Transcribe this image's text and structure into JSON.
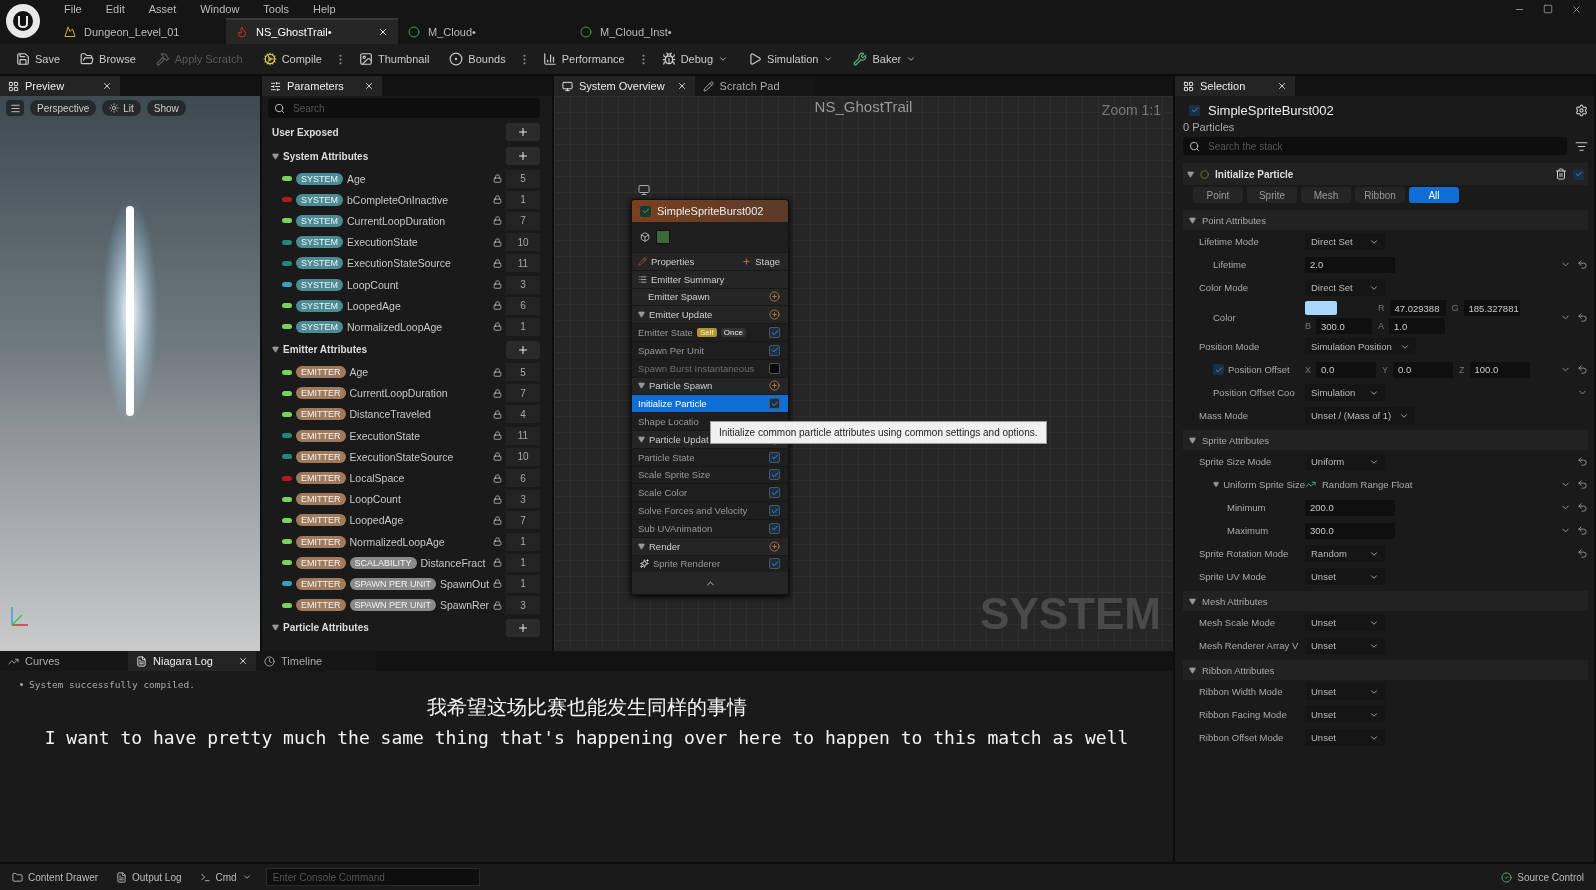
{
  "menu": [
    "File",
    "Edit",
    "Asset",
    "Window",
    "Tools",
    "Help"
  ],
  "documents": [
    {
      "label": "Dungeon_Level_01",
      "kind": "level",
      "selected": false,
      "closable": false
    },
    {
      "label": "NS_GhostTrail•",
      "kind": "system",
      "selected": true,
      "closable": true
    },
    {
      "label": "M_Cloud•",
      "kind": "material",
      "selected": false,
      "closable": false
    },
    {
      "label": "M_Cloud_Inst•",
      "kind": "material",
      "selected": false,
      "closable": false
    }
  ],
  "toolbar": [
    {
      "label": "Save",
      "kind": "save",
      "disabled": false,
      "menu": false,
      "options": false
    },
    {
      "label": "Browse",
      "kind": "browse",
      "disabled": false,
      "menu": false,
      "options": false
    },
    {
      "label": "Apply Scratch",
      "kind": "apply",
      "disabled": true,
      "menu": false,
      "options": false
    },
    {
      "label": "Compile",
      "kind": "compile",
      "disabled": false,
      "menu": false,
      "options": true
    },
    {
      "label": "Thumbnail",
      "kind": "thumbnail",
      "disabled": false,
      "menu": false,
      "options": false
    },
    {
      "label": "Bounds",
      "kind": "bounds",
      "disabled": false,
      "menu": false,
      "options": true
    },
    {
      "label": "Performance",
      "kind": "performance",
      "disabled": false,
      "menu": false,
      "options": true
    },
    {
      "label": "Debug",
      "kind": "debug",
      "disabled": false,
      "menu": true,
      "options": false
    },
    {
      "label": "Simulation",
      "kind": "simulation",
      "disabled": false,
      "menu": true,
      "options": false
    },
    {
      "label": "Baker",
      "kind": "baker",
      "disabled": false,
      "menu": true,
      "options": false
    }
  ],
  "preview": {
    "tab": "Preview",
    "view_buttons": [
      {
        "label": "Perspective",
        "kind": "plain"
      },
      {
        "label": "Lit",
        "kind": "lit"
      },
      {
        "label": "Show",
        "kind": "plain"
      }
    ]
  },
  "parameters": {
    "tab": "Parameters",
    "search": {
      "placeholder": "Search"
    },
    "user_exposed": "User Exposed",
    "sections": [
      {
        "title": "System Attributes",
        "expanded": true,
        "rows": [
          {
            "color": "#7ad25a",
            "tags": [
              {
                "text": "SYSTEM",
                "kind": "system"
              }
            ],
            "name": "Age",
            "locked": true,
            "count": "5"
          },
          {
            "color": "#b01c1c",
            "tags": [
              {
                "text": "SYSTEM",
                "kind": "system"
              }
            ],
            "name": "bCompleteOnInactive",
            "locked": true,
            "count": "1"
          },
          {
            "color": "#7ad25a",
            "tags": [
              {
                "text": "SYSTEM",
                "kind": "system"
              }
            ],
            "name": "CurrentLoopDuration",
            "locked": true,
            "count": "7"
          },
          {
            "color": "#1f8a7a",
            "tags": [
              {
                "text": "SYSTEM",
                "kind": "system"
              }
            ],
            "name": "ExecutionState",
            "locked": true,
            "count": "10"
          },
          {
            "color": "#1f8a7a",
            "tags": [
              {
                "text": "SYSTEM",
                "kind": "system"
              }
            ],
            "name": "ExecutionStateSource",
            "locked": true,
            "count": "11"
          },
          {
            "color": "#3aa0c0",
            "tags": [
              {
                "text": "SYSTEM",
                "kind": "system"
              }
            ],
            "name": "LoopCount",
            "locked": true,
            "count": "3"
          },
          {
            "color": "#7ad25a",
            "tags": [
              {
                "text": "SYSTEM",
                "kind": "system"
              }
            ],
            "name": "LoopedAge",
            "locked": true,
            "count": "6"
          },
          {
            "color": "#7ad25a",
            "tags": [
              {
                "text": "SYSTEM",
                "kind": "system"
              }
            ],
            "name": "NormalizedLoopAge",
            "locked": true,
            "count": "1"
          }
        ]
      },
      {
        "title": "Emitter Attributes",
        "expanded": true,
        "rows": [
          {
            "color": "#7ad25a",
            "tags": [
              {
                "text": "EMITTER",
                "kind": "emitter"
              }
            ],
            "name": "Age",
            "locked": true,
            "count": "5"
          },
          {
            "color": "#7ad25a",
            "tags": [
              {
                "text": "EMITTER",
                "kind": "emitter"
              }
            ],
            "name": "CurrentLoopDuration",
            "locked": true,
            "count": "7"
          },
          {
            "color": "#7ad25a",
            "tags": [
              {
                "text": "EMITTER",
                "kind": "emitter"
              }
            ],
            "name": "DistanceTraveled",
            "locked": true,
            "count": "4"
          },
          {
            "color": "#1f8a7a",
            "tags": [
              {
                "text": "EMITTER",
                "kind": "emitter"
              }
            ],
            "name": "ExecutionState",
            "locked": true,
            "count": "11"
          },
          {
            "color": "#1f8a7a",
            "tags": [
              {
                "text": "EMITTER",
                "kind": "emitter"
              }
            ],
            "name": "ExecutionStateSource",
            "locked": true,
            "count": "10"
          },
          {
            "color": "#b01c1c",
            "tags": [
              {
                "text": "EMITTER",
                "kind": "emitter"
              }
            ],
            "name": "LocalSpace",
            "locked": true,
            "count": "6"
          },
          {
            "color": "#7ad25a",
            "tags": [
              {
                "text": "EMITTER",
                "kind": "emitter"
              }
            ],
            "name": "LoopCount",
            "locked": true,
            "count": "3"
          },
          {
            "color": "#7ad25a",
            "tags": [
              {
                "text": "EMITTER",
                "kind": "emitter"
              }
            ],
            "name": "LoopedAge",
            "locked": true,
            "count": "7"
          },
          {
            "color": "#7ad25a",
            "tags": [
              {
                "text": "EMITTER",
                "kind": "emitter"
              }
            ],
            "name": "NormalizedLoopAge",
            "locked": true,
            "count": "1"
          },
          {
            "color": "#7ad25a",
            "tags": [
              {
                "text": "EMITTER",
                "kind": "emitter"
              },
              {
                "text": "SCALABILITY",
                "kind": "module"
              }
            ],
            "name": "DistanceFract",
            "locked": true,
            "count": "1"
          },
          {
            "color": "#3aa0c0",
            "tags": [
              {
                "text": "EMITTER",
                "kind": "emitter"
              },
              {
                "text": "SPAWN PER UNIT",
                "kind": "module"
              }
            ],
            "name": "SpawnOut",
            "locked": true,
            "count": "1"
          },
          {
            "color": "#7ad25a",
            "tags": [
              {
                "text": "EMITTER",
                "kind": "emitter"
              },
              {
                "text": "SPAWN PER UNIT",
                "kind": "module"
              }
            ],
            "name": "SpawnRer",
            "locked": true,
            "count": "3"
          }
        ]
      },
      {
        "title": "Particle Attributes",
        "expanded": true
      }
    ]
  },
  "graph": {
    "tabs": [
      {
        "label": "System Overview",
        "selected": true,
        "closable": true
      },
      {
        "label": "Scratch Pad",
        "selected": false,
        "closable": false
      }
    ],
    "title": "NS_GhostTrail",
    "zoom": "Zoom 1:1",
    "graph_type": "SYSTEM",
    "node": {
      "title": "SimpleSpriteBurst002",
      "enabled": true,
      "rows": [
        {
          "kind": "properties",
          "label": "Properties",
          "action": "Stage",
          "selected": false
        },
        {
          "kind": "summary",
          "label": "Emitter Summary",
          "selected": false
        },
        {
          "kind": "stage",
          "label": "Emitter Spawn",
          "selected": false
        },
        {
          "kind": "group",
          "label": "Emitter Update",
          "expanded": true,
          "selected": false
        },
        {
          "kind": "module",
          "label": "Emitter State",
          "tags": [
            "Self",
            "Once"
          ],
          "checked": true,
          "disabled": false,
          "selected": false
        },
        {
          "kind": "module",
          "label": "Spawn Per Unit",
          "checked": true,
          "disabled": false,
          "selected": false
        },
        {
          "kind": "module",
          "label": "Spawn Burst Instantaneous",
          "checked": false,
          "disabled": true,
          "selected": false
        },
        {
          "kind": "group",
          "label": "Particle Spawn",
          "expanded": true,
          "selected": false
        },
        {
          "kind": "module",
          "label": "Initialize Particle",
          "checked": true,
          "disabled": false,
          "selected": true
        },
        {
          "kind": "module",
          "label": "Shape Locatio",
          "disabled": false,
          "selected": false
        },
        {
          "kind": "group",
          "label": "Particle Updat",
          "expanded": true,
          "selected": false
        },
        {
          "kind": "module",
          "label": "Particle State",
          "checked": true,
          "disabled": false,
          "selected": false
        },
        {
          "kind": "module",
          "label": "Scale Sprite Size",
          "checked": true,
          "disabled": false,
          "selected": false
        },
        {
          "kind": "module",
          "label": "Scale Color",
          "checked": true,
          "disabled": false,
          "selected": false
        },
        {
          "kind": "module",
          "label": "Solve Forces and Velocity",
          "checked": true,
          "disabled": false,
          "selected": false
        },
        {
          "kind": "module",
          "label": "Sub UVAnimation",
          "checked": true,
          "disabled": false,
          "selected": false
        },
        {
          "kind": "group",
          "label": "Render",
          "expanded": true,
          "selected": false
        },
        {
          "kind": "renderer",
          "label": "Sprite Renderer",
          "checked": true,
          "disabled": false,
          "selected": false
        }
      ]
    },
    "tooltip": "Initialize common particle attributes using common settings and options."
  },
  "selection": {
    "tab": "Selection",
    "title": "SimpleSpriteBurst002",
    "enabled": true,
    "particles": "0 Particles",
    "search": {
      "placeholder": "Search the stack"
    },
    "module": {
      "title": "Initialize Particle",
      "enabled": true,
      "filters": [
        {
          "label": "Point",
          "selected": false
        },
        {
          "label": "Sprite",
          "selected": false
        },
        {
          "label": "Mesh",
          "selected": false
        },
        {
          "label": "Ribbon",
          "selected": false
        },
        {
          "label": "All",
          "selected": true
        }
      ],
      "sections": [
        {
          "title": "Point Attributes",
          "expanded": true,
          "rows": [
            {
              "kind": "select",
              "label": "Lifetime Mode",
              "value": "Direct Set",
              "expand": false,
              "reset": false,
              "children": [
                {
                  "kind": "number",
                  "label": "Lifetime",
                  "value": "2.0",
                  "expand": true,
                  "reset": true
                }
              ]
            },
            {
              "kind": "select",
              "label": "Color Mode",
              "value": "Direct Set",
              "expand": false,
              "reset": false,
              "children": [
                {
                  "kind": "color",
                  "label": "Color",
                  "channels": [
                    {
                      "label": "R",
                      "value": "47.029388"
                    },
                    {
                      "label": "G",
                      "value": "185.327881"
                    },
                    {
                      "label": "B",
                      "value": "300.0"
                    },
                    {
                      "label": "A",
                      "value": "1.0"
                    }
                  ],
                  "expand": true,
                  "reset": true
                }
              ]
            },
            {
              "kind": "select",
              "label": "Position Mode",
              "value": "Simulation Position",
              "expand": false,
              "reset": false,
              "children": [
                {
                  "kind": "vector",
                  "label": "Position Offset",
                  "checked": true,
                  "components": [
                    {
                      "label": "X",
                      "value": "0.0"
                    },
                    {
                      "label": "Y",
                      "value": "0.0"
                    },
                    {
                      "label": "Z",
                      "value": "100.0"
                    }
                  ],
                  "expand": true,
                  "reset": true
                },
                {
                  "kind": "select",
                  "label": "Position Offset Coo",
                  "value": "Simulation",
                  "expand": true,
                  "reset": false
                }
              ]
            },
            {
              "kind": "select",
              "label": "Mass Mode",
              "value": "Unset / (Mass of 1)",
              "expand": false,
              "reset": false
            }
          ]
        },
        {
          "title": "Sprite Attributes",
          "expanded": true,
          "rows": [
            {
              "kind": "select",
              "label": "Sprite Size Mode",
              "value": "Uniform",
              "expand": false,
              "reset": true,
              "children": [
                {
                  "kind": "dynamic",
                  "label": "Uniform Sprite Size",
                  "value": "Random Range Float",
                  "expanded": true,
                  "expand": true,
                  "reset": true,
                  "children": [
                    {
                      "kind": "number",
                      "label": "Minimum",
                      "value": "200.0",
                      "expand": true,
                      "reset": true
                    },
                    {
                      "kind": "number",
                      "label": "Maximum",
                      "value": "300.0",
                      "expand": true,
                      "reset": true
                    }
                  ]
                }
              ]
            },
            {
              "kind": "select",
              "label": "Sprite Rotation Mode",
              "value": "Random",
              "expand": false,
              "reset": true
            },
            {
              "kind": "select",
              "label": "Sprite UV Mode",
              "value": "Unset",
              "expand": false,
              "reset": false
            }
          ]
        },
        {
          "title": "Mesh Attributes",
          "expanded": true,
          "rows": [
            {
              "kind": "select",
              "label": "Mesh Scale Mode",
              "value": "Unset",
              "expand": false,
              "reset": false
            },
            {
              "kind": "select",
              "label": "Mesh Renderer Array V",
              "value": "Unset",
              "expand": false,
              "reset": false
            }
          ]
        },
        {
          "title": "Ribbon Attributes",
          "expanded": true,
          "rows": [
            {
              "kind": "select",
              "label": "Ribbon Width Mode",
              "value": "Unset",
              "expand": false,
              "reset": false
            },
            {
              "kind": "select",
              "label": "Ribbon Facing Mode",
              "value": "Unset",
              "expand": false,
              "reset": false
            },
            {
              "kind": "select",
              "label": "Ribbon Offset Mode",
              "value": "Unset",
              "expand": false,
              "reset": false
            }
          ]
        }
      ]
    }
  },
  "bottom": {
    "tabs": [
      {
        "label": "Curves",
        "selected": false,
        "closable": false
      },
      {
        "label": "Niagara Log",
        "selected": true,
        "closable": true
      },
      {
        "label": "Timeline",
        "selected": false,
        "closable": false
      }
    ],
    "log": [
      "System successfully compiled."
    ]
  },
  "subtitles": [
    "我希望这场比赛也能发生同样的事情",
    "I want to have pretty much the same thing that's happening over here to happen to this match as well"
  ],
  "status_bar": {
    "content_drawer": "Content Drawer",
    "output_log": "Output Log",
    "cmd": "Cmd",
    "console": {
      "placeholder": "Enter Console Command"
    },
    "source_control": "Source Control"
  }
}
